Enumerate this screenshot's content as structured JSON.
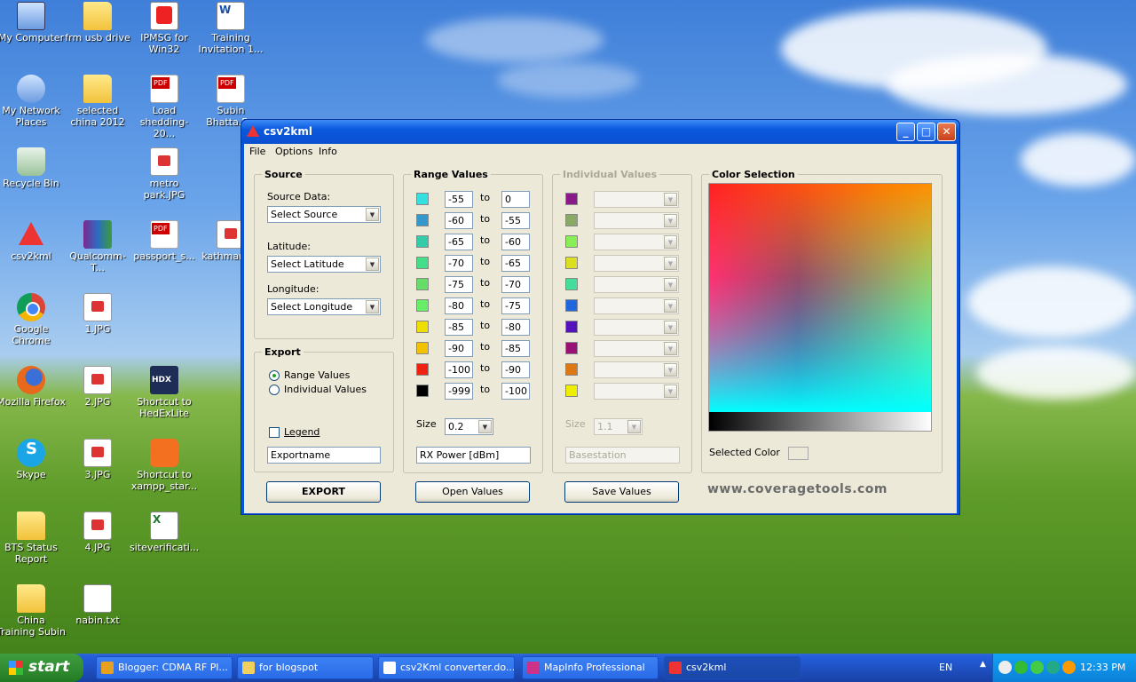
{
  "desktop": {
    "icons": [
      {
        "label": "My Computer",
        "icon": "computer-icon"
      },
      {
        "label": "frm usb drive",
        "icon": "folder-icon"
      },
      {
        "label": "IPMSG for Win32",
        "icon": "ipmsg-icon"
      },
      {
        "label": "Training Invitation 1...",
        "icon": "word-doc-icon"
      },
      {
        "label": "My Network Places",
        "icon": "network-icon"
      },
      {
        "label": "selected china 2012",
        "icon": "folder-icon"
      },
      {
        "label": "Load shedding-20...",
        "icon": "pdf-icon"
      },
      {
        "label": "Subin Bhatta.P...",
        "icon": "pdf-icon"
      },
      {
        "label": "Recycle Bin",
        "icon": "recycle-bin-icon"
      },
      {
        "label": "metro park.JPG",
        "icon": "jpg-icon"
      },
      {
        "label": "csv2kml",
        "icon": "warning-triangle-icon"
      },
      {
        "label": "Qualcomm-T...",
        "icon": "winrar-icon"
      },
      {
        "label": "passport_s...",
        "icon": "pdf-icon"
      },
      {
        "label": "kathmanc...",
        "icon": "shortcut-icon"
      },
      {
        "label": "Google Chrome",
        "icon": "chrome-icon"
      },
      {
        "label": "1.JPG",
        "icon": "jpg-icon"
      },
      {
        "label": "Mozilla Firefox",
        "icon": "firefox-icon"
      },
      {
        "label": "2.JPG",
        "icon": "jpg-icon"
      },
      {
        "label": "Shortcut to HedExLite",
        "icon": "hdx-icon"
      },
      {
        "label": "Skype",
        "icon": "skype-icon"
      },
      {
        "label": "3.JPG",
        "icon": "jpg-icon"
      },
      {
        "label": "Shortcut to xampp_star...",
        "icon": "xampp-icon"
      },
      {
        "label": "BTS Status Report",
        "icon": "folder-icon"
      },
      {
        "label": "4.JPG",
        "icon": "jpg-icon"
      },
      {
        "label": "siteverificati...",
        "icon": "excel-icon"
      },
      {
        "label": "China Training Subin",
        "icon": "folder-icon"
      },
      {
        "label": "nabin.txt",
        "icon": "text-file-icon"
      }
    ]
  },
  "window": {
    "title": "csv2kml",
    "controls": {
      "minimize": "_",
      "maximize": "□",
      "close": "✕"
    },
    "menu": [
      "File",
      "Options",
      "Info"
    ],
    "source": {
      "title": "Source",
      "source_label": "Source Data:",
      "source_value": "Select Source",
      "lat_label": "Latitude:",
      "lat_value": "Select Latitude",
      "lon_label": "Longitude:",
      "lon_value": "Select Longitude"
    },
    "export": {
      "title": "Export",
      "radio_range": "Range Values",
      "radio_individual": "Individual Values",
      "legend_label": "Legend",
      "export_name": "Exportname",
      "export_button": "EXPORT"
    },
    "range": {
      "title": "Range Values",
      "to_label": "to",
      "rows": [
        {
          "color": "#33e0e0",
          "from": "-55",
          "to": "0"
        },
        {
          "color": "#3399cc",
          "from": "-60",
          "to": "-55"
        },
        {
          "color": "#33ccaa",
          "from": "-65",
          "to": "-60"
        },
        {
          "color": "#44dd88",
          "from": "-70",
          "to": "-65"
        },
        {
          "color": "#66dd66",
          "from": "-75",
          "to": "-70"
        },
        {
          "color": "#66ee66",
          "from": "-80",
          "to": "-75"
        },
        {
          "color": "#eedd00",
          "from": "-85",
          "to": "-80"
        },
        {
          "color": "#f2c200",
          "from": "-90",
          "to": "-85"
        },
        {
          "color": "#ee2211",
          "from": "-100",
          "to": "-90"
        },
        {
          "color": "#000000",
          "from": "-999",
          "to": "-100"
        }
      ],
      "size_label": "Size",
      "size_value": "0.2",
      "legend_text": "RX Power [dBm]",
      "open_button": "Open Values"
    },
    "individual": {
      "title": "Individual Values",
      "colors": [
        "#8a1a8a",
        "#88aa66",
        "#88ee55",
        "#dddd22",
        "#44dd99",
        "#2266dd",
        "#5511bb",
        "#991177",
        "#dd7711",
        "#eeee00"
      ],
      "size_label": "Size",
      "size_value": "1.1",
      "legend_text": "Basestation",
      "save_button": "Save Values"
    },
    "color_selection": {
      "title": "Color Selection",
      "selected_label": "Selected Color",
      "brand": "www.coveragetools.com"
    }
  },
  "taskbar": {
    "start_label": "start",
    "tasks": [
      {
        "label": "Blogger: CDMA RF Pl...",
        "icon_color": "#e8a020"
      },
      {
        "label": "for blogspot",
        "icon_color": "#f2d060"
      },
      {
        "label": "csv2Kml converter.do...",
        "icon_color": "#ffffff"
      },
      {
        "label": "MapInfo Professional",
        "icon_color": "#cc3388"
      },
      {
        "label": "csv2kml",
        "icon_color": "#ee3333"
      }
    ],
    "lang": "EN",
    "time": "12:33 PM"
  }
}
